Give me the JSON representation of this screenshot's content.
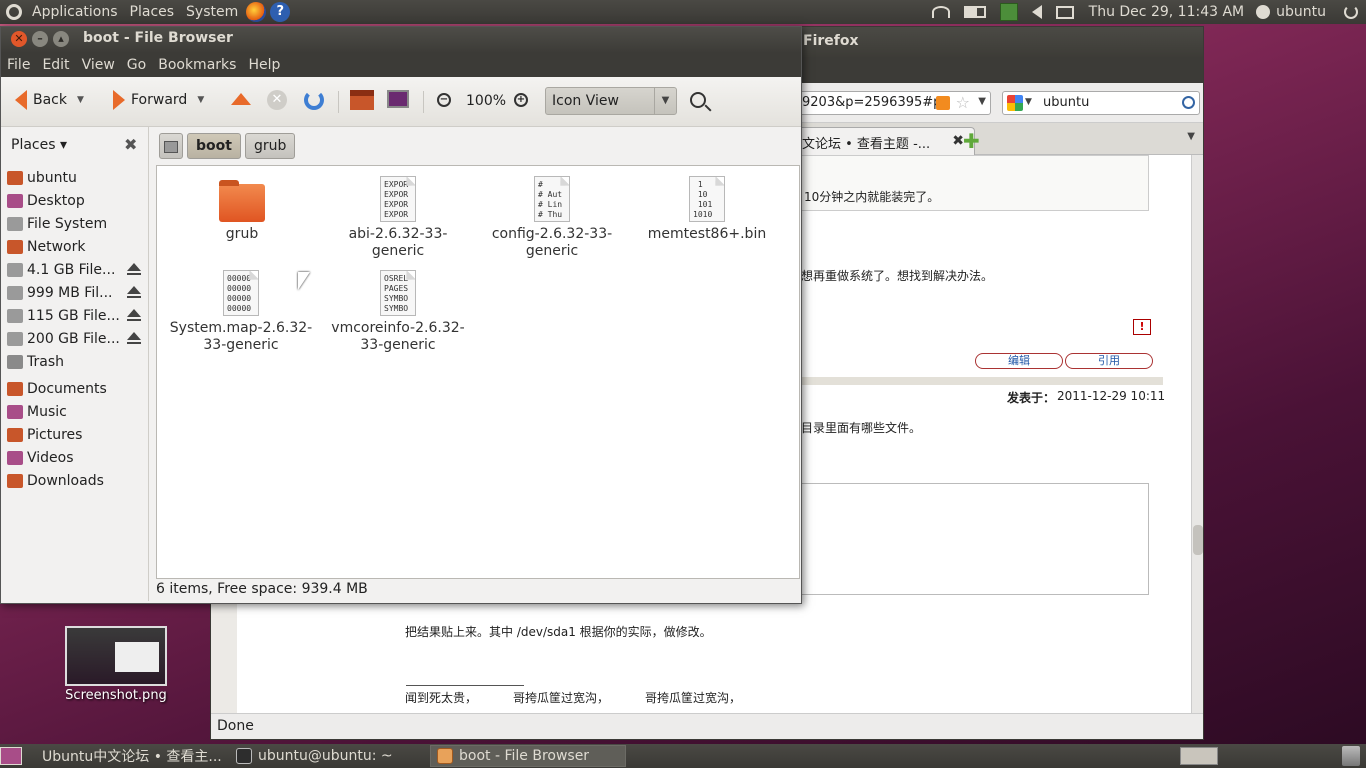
{
  "top_panel": {
    "menus": [
      "Applications",
      "Places",
      "System"
    ],
    "clock": "Thu Dec 29, 11:43 AM",
    "user": "ubuntu"
  },
  "firefox": {
    "title_fragment": "Firefox",
    "url_fragment": "9203&p=2596395#p",
    "search_value": "ubuntu",
    "tab_label": "文论坛 • 查看主题 -...",
    "status": "Done",
    "post_lines": {
      "line1": "10分钟之内就能装完了。",
      "line2": "想再重做系统了。想找到解决办法。",
      "edit": "编辑",
      "quote": "引用",
      "posted_label": "发表于：",
      "posted_date": "2011-12-29 10:11",
      "line3": "目录里面有哪些文件。",
      "line4": "把结果贴上来。其中 /dev/sda1 根据你的实际，做修改。",
      "sig1": "闻到死太贵，",
      "sig2": "哥挎瓜筐过宽沟，",
      "sig3": "哥挎瓜筐过宽沟，"
    }
  },
  "file_browser": {
    "title": "boot - File Browser",
    "menu": [
      "File",
      "Edit",
      "View",
      "Go",
      "Bookmarks",
      "Help"
    ],
    "toolbar": {
      "back": "Back",
      "forward": "Forward",
      "zoom": "100%",
      "view_mode": "Icon View"
    },
    "sidebar": {
      "header": "Places",
      "items": [
        {
          "label": "ubuntu",
          "color": "#c8562a"
        },
        {
          "label": "Desktop",
          "color": "#a84d88"
        },
        {
          "label": "File System",
          "color": "#9a9a9a"
        },
        {
          "label": "Network",
          "color": "#c8562a"
        },
        {
          "label": "4.1 GB File...",
          "color": "#9a9a9a"
        },
        {
          "label": "999 MB Fil...",
          "color": "#9a9a9a"
        },
        {
          "label": "115 GB File...",
          "color": "#9a9a9a"
        },
        {
          "label": "200 GB File...",
          "color": "#9a9a9a"
        },
        {
          "label": "Trash",
          "color": "#8a8a8a"
        },
        {
          "label": "Documents",
          "color": "#c8562a"
        },
        {
          "label": "Music",
          "color": "#a84d88"
        },
        {
          "label": "Pictures",
          "color": "#c8562a"
        },
        {
          "label": "Videos",
          "color": "#a84d88"
        },
        {
          "label": "Downloads",
          "color": "#c8562a"
        }
      ]
    },
    "path": [
      "boot",
      "grub"
    ],
    "files": [
      {
        "name": "grub",
        "type": "folder"
      },
      {
        "name": "abi-2.6.32-33-generic",
        "line1": "abi-2.6.32-33-",
        "line2": "generic",
        "preview": "EXPOR\nEXPOR\nEXPOR\nEXPOR"
      },
      {
        "name": "config-2.6.32-33-generic",
        "line1": "config-2.6.32-33-",
        "line2": "generic",
        "preview": "#\n# Aut\n# Lin\n# Thu"
      },
      {
        "name": "memtest86+.bin",
        "line1": "memtest86+.bin",
        "line2": "",
        "preview": " 1\n 10\n 101\n1010"
      },
      {
        "name": "System.map-2.6.32-33-generic",
        "line1": "System.map-2.6.32-",
        "line2": "33-generic",
        "preview": "00000\n00000\n00000\n00000"
      },
      {
        "name": "vmcoreinfo-2.6.32-33-generic",
        "line1": "vmcoreinfo-2.6.32-",
        "line2": "33-generic",
        "preview": "OSREL\nPAGES\nSYMBO\nSYMBO"
      }
    ],
    "status": "6 items, Free space: 939.4 MB"
  },
  "desktop": {
    "icon_label": "Screenshot.png"
  },
  "bottom_panel": {
    "tasks": [
      "Ubuntu中文论坛 • 查看主...",
      "ubuntu@ubuntu: ~",
      "boot - File Browser"
    ]
  }
}
